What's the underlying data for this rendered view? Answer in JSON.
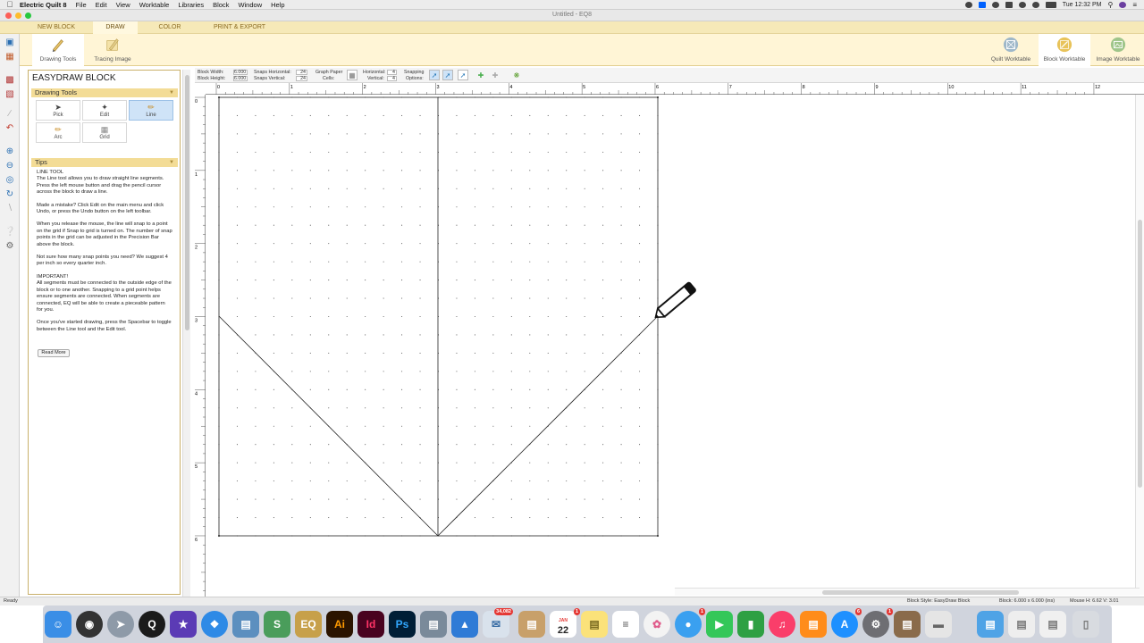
{
  "menubar": {
    "app_name": "Electric Quilt 8",
    "items": [
      "File",
      "Edit",
      "View",
      "Worktable",
      "Libraries",
      "Block",
      "Window",
      "Help"
    ],
    "clock": "Tue 12:32 PM"
  },
  "window": {
    "title": "Untitled - EQ8"
  },
  "ribbon": {
    "tabs": [
      "NEW BLOCK",
      "DRAW",
      "COLOR",
      "PRINT & EXPORT"
    ],
    "active_tab": "DRAW",
    "left_buttons": [
      "Drawing Tools",
      "Tracing Image"
    ],
    "right_buttons": [
      "Quilt Worktable",
      "Block Worktable",
      "Image Worktable"
    ]
  },
  "panel": {
    "title": "EASYDRAW BLOCK",
    "drawing_tools_header": "Drawing Tools",
    "tools": [
      "Pick",
      "Edit",
      "Line",
      "Arc",
      "Grid"
    ],
    "selected_tool": "Line",
    "tips_header": "Tips",
    "tips": {
      "heading": "LINE TOOL",
      "p1": "The Line tool allows you to draw straight line segments. Press the left mouse button and drag the pencil cursor across the block to draw a line.",
      "p2": "Made a mistake? Click Edit on the main menu and click Undo, or press the Undo button on the left toolbar.",
      "p3": "When you release the mouse, the line will snap to a point on the grid if Snap to grid is turned on. The number of snap points in the grid can be adjusted in the Precision Bar above the block.",
      "p4": "Not sure how many snap points you need? We suggest 4 per inch so every quarter inch.",
      "p5_title": "IMPORTANT!",
      "p5": "All segments must be connected to the outside edge of the block or to one another. Snapping to a grid point helps ensure segments are connected. When segments are connected, EQ will be able to create a pieceable pattern for you.",
      "p6": "Once you've started drawing, press the Spacebar to toggle between the Line tool and the Edit tool.",
      "read_more": "Read More"
    }
  },
  "precision_bar": {
    "block_width_label": "Block Width:",
    "block_width": "6.000",
    "block_height_label": "Block Height:",
    "block_height": "6.000",
    "snaps_h_label": "Snaps Horizontal:",
    "snaps_h": "24",
    "snaps_v_label": "Snaps Vertical:",
    "snaps_v": "24",
    "graph_label_1": "Graph Paper",
    "graph_label_2": "Cells:",
    "horizontal_label": "Horizontal:",
    "horizontal": "4",
    "vertical_label": "Vertical:",
    "vertical": "4",
    "snapping_label_1": "Snapping",
    "snapping_label_2": "Options:"
  },
  "rulers": {
    "h_ticks": [
      "0",
      "1",
      "2",
      "3",
      "4",
      "5",
      "6",
      "7",
      "8",
      "9",
      "10",
      "11",
      "12"
    ],
    "v_ticks": [
      "0",
      "1",
      "2",
      "3",
      "4",
      "5",
      "6"
    ]
  },
  "status": {
    "left": "Ready",
    "block_style": "Block Style: EasyDraw Block",
    "block_size": "Block: 6.000 x 6.000 (ins)",
    "mouse": "Mouse   H: 6.62   V: 3.01"
  },
  "dock": {
    "badges": {
      "mail": "34,082",
      "calendar_date": "22",
      "calendar_month": "JAN",
      "messages": "1",
      "appstore": "6",
      "prefs": "1"
    }
  },
  "colors": {
    "ribbon": "#f6e9b8",
    "accent": "#2a6fb3"
  }
}
